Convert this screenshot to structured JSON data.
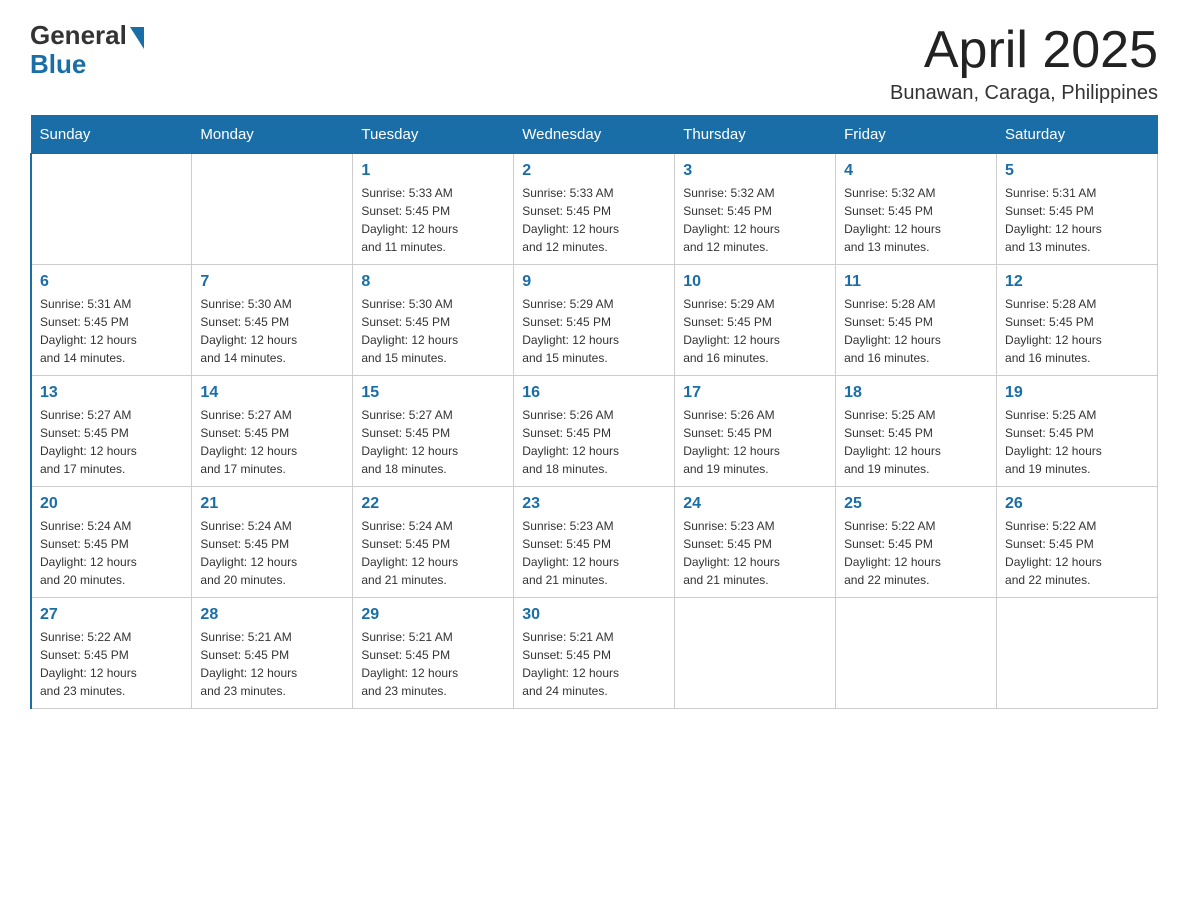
{
  "logo": {
    "general": "General",
    "blue": "Blue"
  },
  "header": {
    "month": "April 2025",
    "location": "Bunawan, Caraga, Philippines"
  },
  "days_of_week": [
    "Sunday",
    "Monday",
    "Tuesday",
    "Wednesday",
    "Thursday",
    "Friday",
    "Saturday"
  ],
  "weeks": [
    [
      {
        "day": "",
        "info": ""
      },
      {
        "day": "",
        "info": ""
      },
      {
        "day": "1",
        "info": "Sunrise: 5:33 AM\nSunset: 5:45 PM\nDaylight: 12 hours\nand 11 minutes."
      },
      {
        "day": "2",
        "info": "Sunrise: 5:33 AM\nSunset: 5:45 PM\nDaylight: 12 hours\nand 12 minutes."
      },
      {
        "day": "3",
        "info": "Sunrise: 5:32 AM\nSunset: 5:45 PM\nDaylight: 12 hours\nand 12 minutes."
      },
      {
        "day": "4",
        "info": "Sunrise: 5:32 AM\nSunset: 5:45 PM\nDaylight: 12 hours\nand 13 minutes."
      },
      {
        "day": "5",
        "info": "Sunrise: 5:31 AM\nSunset: 5:45 PM\nDaylight: 12 hours\nand 13 minutes."
      }
    ],
    [
      {
        "day": "6",
        "info": "Sunrise: 5:31 AM\nSunset: 5:45 PM\nDaylight: 12 hours\nand 14 minutes."
      },
      {
        "day": "7",
        "info": "Sunrise: 5:30 AM\nSunset: 5:45 PM\nDaylight: 12 hours\nand 14 minutes."
      },
      {
        "day": "8",
        "info": "Sunrise: 5:30 AM\nSunset: 5:45 PM\nDaylight: 12 hours\nand 15 minutes."
      },
      {
        "day": "9",
        "info": "Sunrise: 5:29 AM\nSunset: 5:45 PM\nDaylight: 12 hours\nand 15 minutes."
      },
      {
        "day": "10",
        "info": "Sunrise: 5:29 AM\nSunset: 5:45 PM\nDaylight: 12 hours\nand 16 minutes."
      },
      {
        "day": "11",
        "info": "Sunrise: 5:28 AM\nSunset: 5:45 PM\nDaylight: 12 hours\nand 16 minutes."
      },
      {
        "day": "12",
        "info": "Sunrise: 5:28 AM\nSunset: 5:45 PM\nDaylight: 12 hours\nand 16 minutes."
      }
    ],
    [
      {
        "day": "13",
        "info": "Sunrise: 5:27 AM\nSunset: 5:45 PM\nDaylight: 12 hours\nand 17 minutes."
      },
      {
        "day": "14",
        "info": "Sunrise: 5:27 AM\nSunset: 5:45 PM\nDaylight: 12 hours\nand 17 minutes."
      },
      {
        "day": "15",
        "info": "Sunrise: 5:27 AM\nSunset: 5:45 PM\nDaylight: 12 hours\nand 18 minutes."
      },
      {
        "day": "16",
        "info": "Sunrise: 5:26 AM\nSunset: 5:45 PM\nDaylight: 12 hours\nand 18 minutes."
      },
      {
        "day": "17",
        "info": "Sunrise: 5:26 AM\nSunset: 5:45 PM\nDaylight: 12 hours\nand 19 minutes."
      },
      {
        "day": "18",
        "info": "Sunrise: 5:25 AM\nSunset: 5:45 PM\nDaylight: 12 hours\nand 19 minutes."
      },
      {
        "day": "19",
        "info": "Sunrise: 5:25 AM\nSunset: 5:45 PM\nDaylight: 12 hours\nand 19 minutes."
      }
    ],
    [
      {
        "day": "20",
        "info": "Sunrise: 5:24 AM\nSunset: 5:45 PM\nDaylight: 12 hours\nand 20 minutes."
      },
      {
        "day": "21",
        "info": "Sunrise: 5:24 AM\nSunset: 5:45 PM\nDaylight: 12 hours\nand 20 minutes."
      },
      {
        "day": "22",
        "info": "Sunrise: 5:24 AM\nSunset: 5:45 PM\nDaylight: 12 hours\nand 21 minutes."
      },
      {
        "day": "23",
        "info": "Sunrise: 5:23 AM\nSunset: 5:45 PM\nDaylight: 12 hours\nand 21 minutes."
      },
      {
        "day": "24",
        "info": "Sunrise: 5:23 AM\nSunset: 5:45 PM\nDaylight: 12 hours\nand 21 minutes."
      },
      {
        "day": "25",
        "info": "Sunrise: 5:22 AM\nSunset: 5:45 PM\nDaylight: 12 hours\nand 22 minutes."
      },
      {
        "day": "26",
        "info": "Sunrise: 5:22 AM\nSunset: 5:45 PM\nDaylight: 12 hours\nand 22 minutes."
      }
    ],
    [
      {
        "day": "27",
        "info": "Sunrise: 5:22 AM\nSunset: 5:45 PM\nDaylight: 12 hours\nand 23 minutes."
      },
      {
        "day": "28",
        "info": "Sunrise: 5:21 AM\nSunset: 5:45 PM\nDaylight: 12 hours\nand 23 minutes."
      },
      {
        "day": "29",
        "info": "Sunrise: 5:21 AM\nSunset: 5:45 PM\nDaylight: 12 hours\nand 23 minutes."
      },
      {
        "day": "30",
        "info": "Sunrise: 5:21 AM\nSunset: 5:45 PM\nDaylight: 12 hours\nand 24 minutes."
      },
      {
        "day": "",
        "info": ""
      },
      {
        "day": "",
        "info": ""
      },
      {
        "day": "",
        "info": ""
      }
    ]
  ]
}
